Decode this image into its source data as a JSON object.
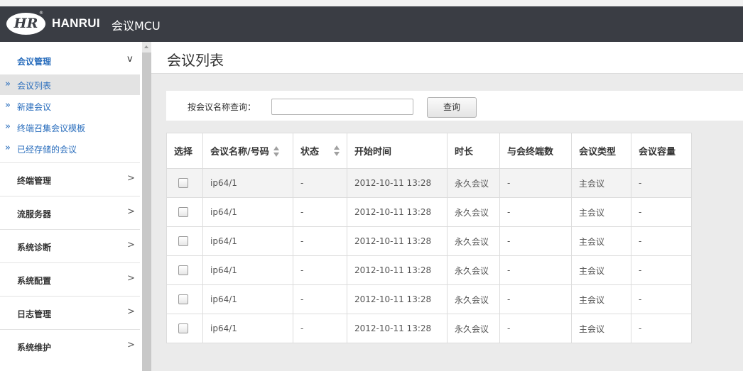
{
  "header": {
    "logo_text": "HR",
    "brand": "HANRUI",
    "product": "会议MCU"
  },
  "sidebar": {
    "open_menu": {
      "label": "会议管理",
      "chevron": "v"
    },
    "sub_items": [
      {
        "label": "会议列表",
        "bullet": "»",
        "active": true
      },
      {
        "label": "新建会议",
        "bullet": "»"
      },
      {
        "label": "终端召集会议模板",
        "bullet": "»"
      },
      {
        "label": "已经存储的会议",
        "bullet": "»"
      }
    ],
    "menus": [
      {
        "label": "终端管理",
        "chevron": ">"
      },
      {
        "label": "流服务器",
        "chevron": ">"
      },
      {
        "label": "系统诊断",
        "chevron": ">"
      },
      {
        "label": "系统配置",
        "chevron": ">"
      },
      {
        "label": "日志管理",
        "chevron": ">"
      },
      {
        "label": "系统维护",
        "chevron": ">"
      }
    ]
  },
  "page": {
    "title": "会议列表"
  },
  "search": {
    "label": "按会议名称查询：",
    "input_value": "",
    "button_label": "查询"
  },
  "table": {
    "headers": [
      "选择",
      "会议名称/号码",
      "状态",
      "开始时间",
      "时长",
      "与会终端数",
      "会议类型",
      "会议容量"
    ],
    "rows": [
      [
        "ip64/1",
        "-",
        "2012-10-11 13:28",
        "永久会议",
        "-",
        "主会议",
        "-"
      ],
      [
        "ip64/1",
        "-",
        "2012-10-11 13:28",
        "永久会议",
        "-",
        "主会议",
        "-"
      ],
      [
        "ip64/1",
        "-",
        "2012-10-11 13:28",
        "永久会议",
        "-",
        "主会议",
        "-"
      ],
      [
        "ip64/1",
        "-",
        "2012-10-11 13:28",
        "永久会议",
        "-",
        "主会议",
        "-"
      ],
      [
        "ip64/1",
        "-",
        "2012-10-11 13:28",
        "永久会议",
        "-",
        "主会议",
        "-"
      ],
      [
        "ip64/1",
        "-",
        "2012-10-11 13:28",
        "永久会议",
        "-",
        "主会议",
        "-"
      ]
    ]
  },
  "colors": {
    "header_bg": "#3a3d44",
    "accent_blue": "#2a6ebd",
    "page_bg": "#ebebeb"
  }
}
